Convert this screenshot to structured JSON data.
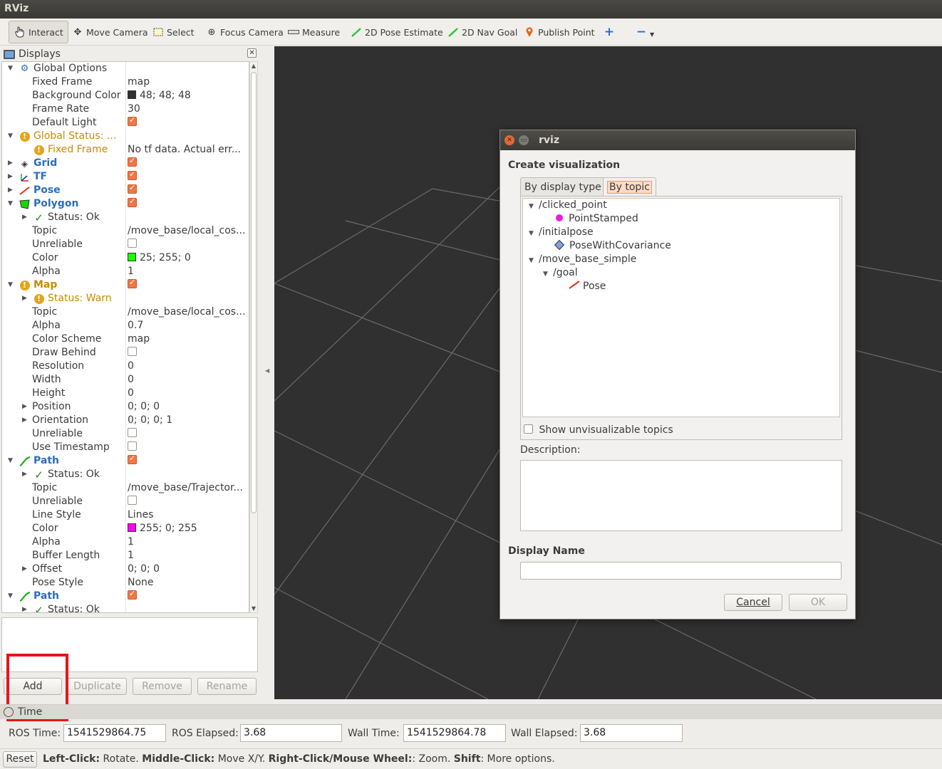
{
  "window": {
    "title": "RViz"
  },
  "toolbar": {
    "tools": [
      {
        "label": "Interact",
        "icon": "hand-pointer-icon",
        "active": true
      },
      {
        "label": "Move Camera",
        "icon": "move-camera-icon"
      },
      {
        "label": "Select",
        "icon": "select-rect-icon"
      },
      {
        "label": "Focus Camera",
        "icon": "focus-crosshair-icon"
      },
      {
        "label": "Measure",
        "icon": "ruler-icon"
      },
      {
        "label": "2D Pose Estimate",
        "icon": "green-arrow-icon"
      },
      {
        "label": "2D Nav Goal",
        "icon": "green-arrow-icon"
      },
      {
        "label": "Publish Point",
        "icon": "map-pin-icon"
      }
    ],
    "add_tool_icon": "plus-icon",
    "remove_tool_icon": "minus-icon"
  },
  "displays_panel": {
    "title": "Displays",
    "rows": [
      {
        "name": "Global Options"
      },
      {
        "name": "Fixed Frame",
        "value": "map"
      },
      {
        "name": "Background Color",
        "value": "48; 48; 48"
      },
      {
        "name": "Frame Rate",
        "value": "30"
      },
      {
        "name": "Default Light"
      },
      {
        "name": "Global Status: ..."
      },
      {
        "name": "Fixed Frame",
        "value": "No tf data.  Actual err..."
      },
      {
        "name": "Grid"
      },
      {
        "name": "TF"
      },
      {
        "name": "Pose"
      },
      {
        "name": "Polygon"
      },
      {
        "name": "Status: Ok"
      },
      {
        "name": "Topic",
        "value": "/move_base/local_cos..."
      },
      {
        "name": "Unreliable"
      },
      {
        "name": "Color",
        "value": "25; 255; 0"
      },
      {
        "name": "Alpha",
        "value": "1"
      },
      {
        "name": "Map"
      },
      {
        "name": "Status: Warn"
      },
      {
        "name": "Topic",
        "value": "/move_base/local_cos..."
      },
      {
        "name": "Alpha",
        "value": "0.7"
      },
      {
        "name": "Color Scheme",
        "value": "map"
      },
      {
        "name": "Draw Behind"
      },
      {
        "name": "Resolution",
        "value": "0"
      },
      {
        "name": "Width",
        "value": "0"
      },
      {
        "name": "Height",
        "value": "0"
      },
      {
        "name": "Position",
        "value": "0; 0; 0"
      },
      {
        "name": "Orientation",
        "value": "0; 0; 0; 1"
      },
      {
        "name": "Unreliable"
      },
      {
        "name": "Use Timestamp"
      },
      {
        "name": "Path"
      },
      {
        "name": "Status: Ok"
      },
      {
        "name": "Topic",
        "value": "/move_base/Trajector..."
      },
      {
        "name": "Unreliable"
      },
      {
        "name": "Line Style",
        "value": "Lines"
      },
      {
        "name": "Color",
        "value": "255; 0; 255"
      },
      {
        "name": "Alpha",
        "value": "1"
      },
      {
        "name": "Buffer Length",
        "value": "1"
      },
      {
        "name": "Offset",
        "value": "0; 0; 0"
      },
      {
        "name": "Pose Style",
        "value": "None"
      },
      {
        "name": "Path"
      },
      {
        "name": "Status: Ok"
      }
    ],
    "checkboxes": {
      "default_light": true,
      "grid": true,
      "tf": true,
      "pose": true,
      "polygon": true,
      "polygon_unreliable": false,
      "map": true,
      "map_draw_behind": false,
      "map_unreliable": false,
      "map_use_timestamp": false,
      "path": true,
      "path_unreliable": false,
      "path2": true
    },
    "colors": {
      "background": "#303030",
      "polygon": "#19ff00",
      "path": "#ff00ff"
    },
    "buttons": {
      "add": "Add",
      "duplicate": "Duplicate",
      "remove": "Remove",
      "rename": "Rename"
    }
  },
  "time_panel": {
    "title": "Time",
    "ros_time_label": "ROS Time:",
    "ros_time": "1541529864.75",
    "ros_elapsed_label": "ROS Elapsed:",
    "ros_elapsed": "3.68",
    "wall_time_label": "Wall Time:",
    "wall_time": "1541529864.78",
    "wall_elapsed_label": "Wall Elapsed:",
    "wall_elapsed": "3.68"
  },
  "statusbar": {
    "reset": "Reset",
    "hint_parts": [
      {
        "text": "Left-Click:",
        "bold": true
      },
      {
        "text": " Rotate. "
      },
      {
        "text": "Middle-Click:",
        "bold": true
      },
      {
        "text": " Move X/Y. "
      },
      {
        "text": "Right-Click/Mouse Wheel:",
        "bold": true
      },
      {
        "text": ": Zoom. "
      },
      {
        "text": "Shift",
        "bold": true
      },
      {
        "text": ": More options."
      }
    ]
  },
  "dialog": {
    "title": "rviz",
    "heading": "Create visualization",
    "tabs": [
      "By display type",
      "By topic"
    ],
    "selected_tab": "By topic",
    "topics": [
      {
        "label": "/clicked_point"
      },
      {
        "label": "PointStamped"
      },
      {
        "label": "/initialpose"
      },
      {
        "label": "PoseWithCovariance"
      },
      {
        "label": "/move_base_simple"
      },
      {
        "label": "/goal"
      },
      {
        "label": "Pose"
      }
    ],
    "show_unvisualizable": "Show unvisualizable topics",
    "description_label": "Description:",
    "display_name_label": "Display Name",
    "cancel": "Cancel",
    "ok": "OK"
  }
}
